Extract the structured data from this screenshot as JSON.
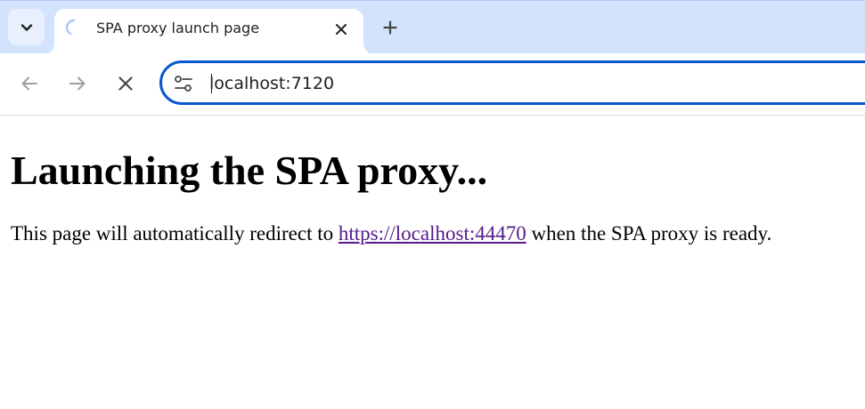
{
  "browser": {
    "tab": {
      "title": "SPA proxy launch page",
      "loading": true
    },
    "icons": {
      "tab_search": "chevron-down-icon",
      "tab_loading": "spinner-icon",
      "tab_close": "close-icon",
      "new_tab": "plus-icon",
      "back": "arrow-left-icon",
      "forward": "arrow-right-icon",
      "stop": "close-icon",
      "site_info": "tune-icon"
    },
    "address_bar": {
      "value": "localhost:7120"
    },
    "colors": {
      "tabstrip_bg": "#d3e3fd",
      "omnibox_focus": "#0b57d0",
      "visited_link": "#551a8b"
    }
  },
  "page": {
    "heading": "Launching the SPA proxy...",
    "message_before": "This page will automatically redirect to ",
    "link_text": "https://localhost:44470",
    "message_after": " when the SPA proxy is ready."
  }
}
